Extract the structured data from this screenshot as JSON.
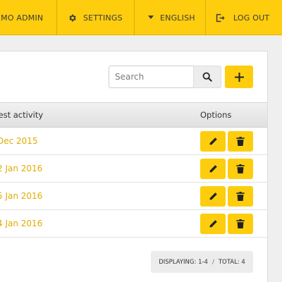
{
  "topbar": {
    "user_label": "EMO ADMIN",
    "settings_label": "SETTINGS",
    "language_label": "ENGLISH",
    "logout_label": "LOG OUT"
  },
  "toolbar": {
    "search_placeholder": "Search",
    "search_value": ""
  },
  "table": {
    "headers": {
      "latest_activity": "test activity",
      "options": "Options"
    },
    "rows": [
      {
        "latest_activity": "Dec 2015"
      },
      {
        "latest_activity": "2 Jan 2016"
      },
      {
        "latest_activity": "5 Jan 2016"
      },
      {
        "latest_activity": "4 Jan 2016"
      }
    ]
  },
  "pagination": {
    "displaying": "DISPLAYING: 1-4",
    "separator": "/",
    "total": "TOTAL: 4"
  },
  "icons": {
    "settings": "gear-icon",
    "language": "caret-down-icon",
    "logout": "logout-icon",
    "search": "search-icon",
    "add": "plus-icon",
    "edit": "pencil-icon",
    "delete": "trash-icon"
  },
  "colors": {
    "accent": "#fdcd0e",
    "link": "#e0ac00",
    "text": "#333333"
  }
}
